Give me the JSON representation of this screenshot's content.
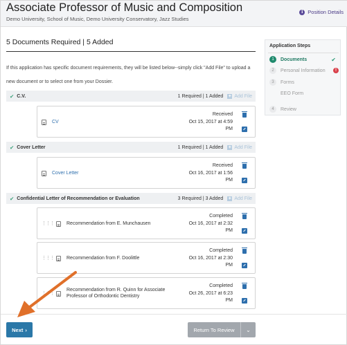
{
  "header": {
    "title": "Associate Professor of Music and Composition",
    "subtitle": "Demo University, School of Music, Demo University Conservatory, Jazz Studies",
    "position_details": "Position Details",
    "info_icon": "i"
  },
  "main": {
    "title": "5 Documents Required | 5 Added",
    "intro": "If this application has specific document requirements, they will be listed below--simply click \"Add File\" to upload a new document or to select one from your Dossier.",
    "add_file_label": "Add File",
    "sections": [
      {
        "title": "C.V.",
        "counts": "1 Required | 1 Added",
        "documents": [
          {
            "name": "CV",
            "status_line1": "Received",
            "status_line2": "Oct 15, 2017 at 4:59",
            "status_line3": "PM"
          }
        ]
      },
      {
        "title": "Cover Letter",
        "counts": "1 Required | 1 Added",
        "documents": [
          {
            "name": "Cover Letter",
            "status_line1": "Received",
            "status_line2": "Oct 16, 2017 at 1:56",
            "status_line3": "PM"
          }
        ]
      },
      {
        "title": "Confidential Letter of Recommendation or Evaluation",
        "counts": "3 Required | 3 Added",
        "documents": [
          {
            "name": "Recommendation from E. Munchausen",
            "status_line1": "Completed",
            "status_line2": "Oct 16, 2017 at 2:32",
            "status_line3": "PM"
          },
          {
            "name": "Recommendation from F. Doolittle",
            "status_line1": "Completed",
            "status_line2": "Oct 16, 2017 at 2:30",
            "status_line3": "PM"
          },
          {
            "name": "Recommendation from R. Quinn for Associate Professor of Orthodontic Dentistry",
            "status_line1": "Completed",
            "status_line2": "Oct 26, 2017 at 6:23",
            "status_line3": "PM"
          }
        ]
      }
    ]
  },
  "sidebar": {
    "title": "Application Steps",
    "steps": [
      {
        "number": "1",
        "label": "Documents",
        "state": "complete"
      },
      {
        "number": "2",
        "label": "Personal Information",
        "state": "error"
      },
      {
        "number": "3",
        "label": "Forms",
        "state": "pending"
      },
      {
        "number": "",
        "label": "EEO Form",
        "state": "substep"
      },
      {
        "number": "4",
        "label": "Review",
        "state": "pending"
      }
    ]
  },
  "footer": {
    "next_label": "Next",
    "review_label": "Return To Review"
  },
  "colors": {
    "accent": "#2b78a8",
    "active_step": "#1f8a6d",
    "error": "#d9404a",
    "annotation_arrow": "#e0702a"
  },
  "icons": {
    "check": "check-circle-icon",
    "add": "plus-square-icon",
    "file": "file-icon",
    "trash": "trash-icon",
    "edit": "edit-icon",
    "drag": "drag-handle-icon",
    "caret": "chevron-down-icon"
  }
}
